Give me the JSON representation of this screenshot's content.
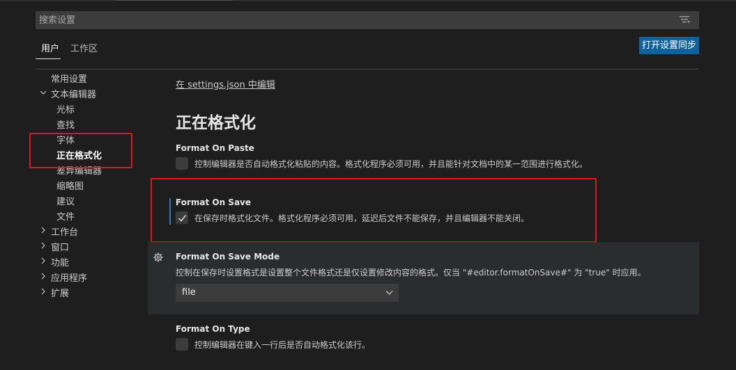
{
  "search": {
    "placeholder": "搜索设置"
  },
  "tabs": [
    {
      "label": "用户"
    },
    {
      "label": "工作区"
    }
  ],
  "sync_button": "打开设置同步",
  "toc": [
    {
      "label": "常用设置"
    },
    {
      "label": "文本编辑器"
    },
    {
      "label": "光标"
    },
    {
      "label": "查找"
    },
    {
      "label": "字体"
    },
    {
      "label": "正在格式化"
    },
    {
      "label": "差异编辑器"
    },
    {
      "label": "缩略图"
    },
    {
      "label": "建议"
    },
    {
      "label": "文件"
    },
    {
      "label": "工作台"
    },
    {
      "label": "窗口"
    },
    {
      "label": "功能"
    },
    {
      "label": "应用程序"
    },
    {
      "label": "扩展"
    }
  ],
  "edit_link": "在 settings.json 中编辑",
  "section_title": "正在格式化",
  "settings": {
    "format_on_paste": {
      "title": "Format On Paste",
      "description": "控制编辑器是否自动格式化粘贴的内容。格式化程序必须可用，并且能针对文档中的某一范围进行格式化。",
      "checked": false
    },
    "format_on_save": {
      "title": "Format On Save",
      "description": "在保存时格式化文件。格式化程序必须可用，延迟后文件不能保存，并且编辑器不能关闭。",
      "checked": true
    },
    "format_on_save_mode": {
      "title": "Format On Save Mode",
      "description": "控制在保存时设置格式是设置整个文件格式还是仅设置修改内容的格式。仅当 \"#editor.formatOnSave#\" 为 \"true\" 时应用。",
      "value": "file"
    },
    "format_on_type": {
      "title": "Format On Type",
      "description": "控制编辑器在键入一行后是否自动格式化该行。",
      "checked": false
    }
  },
  "colors": {
    "accent": "#0e639c",
    "highlight_box": "#e8141b",
    "focus_bar": "#2f79b8"
  },
  "icons": [
    "filter-icon",
    "chevron-down-icon",
    "chevron-right-icon",
    "gear-icon",
    "check-icon"
  ]
}
